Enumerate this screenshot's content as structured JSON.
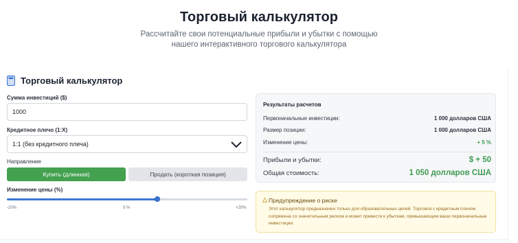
{
  "hero": {
    "title": "Торговый калькулятор",
    "subtitle_line1": "Рассчитайте свои потенциальные прибыли и убытки с помощью",
    "subtitle_line2": "нашего интерактивного торгового калькулятора"
  },
  "card": {
    "title": "Торговый калькулятор",
    "icon": "calculator-icon"
  },
  "form": {
    "investment_label": "Сумма инвестиций ($)",
    "investment_value": "1000",
    "leverage_label": "Кредитное плечо (1:X)",
    "leverage_value": "1:1 (без кредитного плеча)",
    "direction_label": "Направление",
    "buy_label": "Купить (длинная)",
    "sell_label": "Продать (короткая позиция)",
    "selected_direction": "buy",
    "price_change_label": "Изменение цены (%)",
    "slider": {
      "min_label": "-20%",
      "mid_label": "5 %",
      "max_label": "+20%",
      "min": -20,
      "max": 20,
      "value": 5
    }
  },
  "results": {
    "title": "Результаты расчетов",
    "initial_label": "Первоначальные инвестиции:",
    "initial_value": "1 000 долларов США",
    "position_label": "Размер позиции:",
    "position_value": "1 000 долларов США",
    "change_label": "Изменение цены:",
    "change_value": "+ 5 %",
    "pnl_label": "Прибыли и убытки:",
    "pnl_value": "$ + 50",
    "total_label": "Общая стоимость:",
    "total_value": "1 050 долларов США"
  },
  "warning": {
    "title": "Предупреждение о риске",
    "text": "Этот калькулятор предназначен только для образовательных целей. Торговля с кредитным плечом сопряжена со значительным риском и может привести к убыткам, превышающим ваши первоначальные инвестиции."
  },
  "colors": {
    "accent_blue": "#3a76d6",
    "buy_green": "#43a14f",
    "profit_green": "#3f9a52",
    "warning_bg": "#fffbe6",
    "warning_text": "#9a6a1f"
  }
}
